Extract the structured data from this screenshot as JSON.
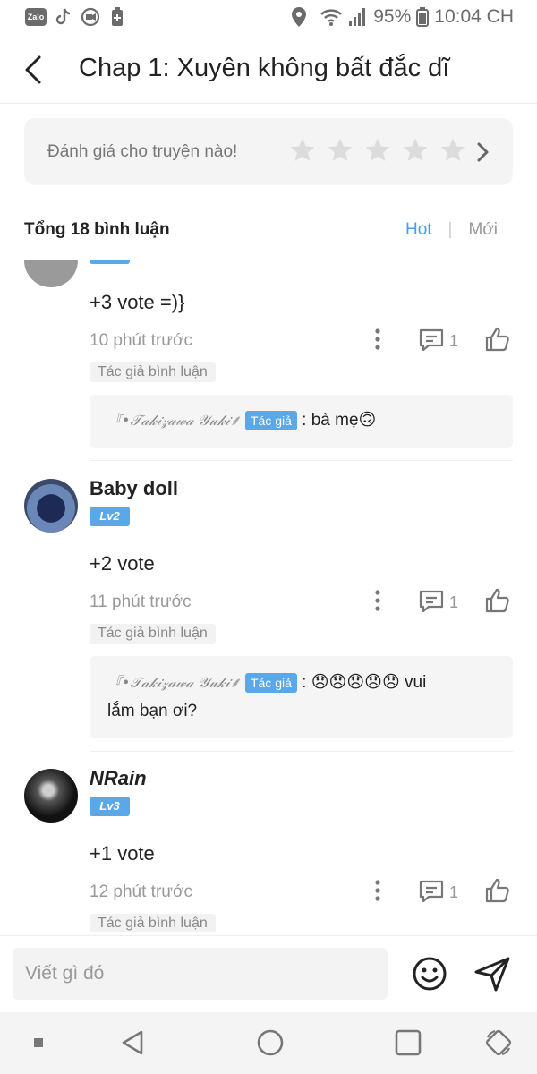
{
  "status_bar": {
    "apps": [
      "zalo-icon",
      "tiktok-icon",
      "camera-record-icon",
      "battery-saver-icon"
    ],
    "zalo_label": "Zalo",
    "battery_percent": "95%",
    "time": "10:04 CH"
  },
  "header": {
    "title": "Chap 1: Xuyên không bất đắc dĩ"
  },
  "rating": {
    "prompt": "Đánh giá cho truyện nào!",
    "stars": 5
  },
  "comments_header": {
    "total": "Tổng 18 bình luận",
    "sort_hot": "Hot",
    "sort_new": "Mới"
  },
  "comments": [
    {
      "vote": "+3 vote =)}",
      "time": "10 phút trước",
      "reply_count": "1",
      "tag": "Tác giả bình luận",
      "reply_author": "『•𝒯𝒶𝓀𝒾𝓏𝒶𝓌𝒶 𝒴𝓊𝓀𝒾⸙",
      "reply_badge": "Tác giả",
      "reply_text": ": bà mẹ🙃"
    },
    {
      "username": "Baby doll",
      "level": "Lv2",
      "vote": "+2 vote",
      "time": "11 phút trước",
      "reply_count": "1",
      "tag": "Tác giả bình luận",
      "reply_author": "『•𝒯𝒶𝓀𝒾𝓏𝒶𝓌𝒶 𝒴𝓊𝓀𝒾⸙",
      "reply_badge": "Tác giả",
      "reply_text_a": ": 😞😞😞😞😞 vui",
      "reply_text_b": "lắm bạn ơi?"
    },
    {
      "username": "NRain",
      "level": "Lv3",
      "vote": "+1 vote",
      "time": "12 phút trước",
      "reply_count": "1",
      "tag": "Tác giả bình luận"
    }
  ],
  "input": {
    "placeholder": "Viết gì đó"
  },
  "colors": {
    "accent": "#4a9ee8",
    "badge": "#5aa8e8"
  }
}
